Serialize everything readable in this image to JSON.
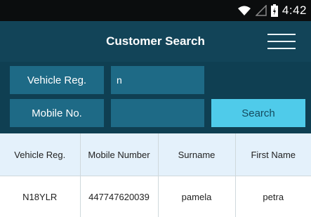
{
  "status_bar": {
    "time": "4:42",
    "icons": [
      "wifi-icon",
      "signal-icon",
      "battery-icon"
    ]
  },
  "header": {
    "title": "Customer Search",
    "menu_icon": "hamburger-menu-icon"
  },
  "form": {
    "vehicle_reg_label": "Vehicle Reg.",
    "vehicle_reg_value": "n",
    "mobile_label": "Mobile No.",
    "mobile_value": "",
    "search_label": "Search"
  },
  "table": {
    "columns": [
      "Vehicle Reg.",
      "Mobile Number",
      "Surname",
      "First Name"
    ],
    "rows": [
      [
        "N18YLR",
        "447747620039",
        "pamela",
        "petra"
      ]
    ]
  },
  "colors": {
    "status_bar": "#0b0d0e",
    "header": "#124458",
    "form_background": "#0f3f52",
    "field": "#1e6a86",
    "search_button": "#4fcbea",
    "table_header": "#e4f1fb"
  }
}
